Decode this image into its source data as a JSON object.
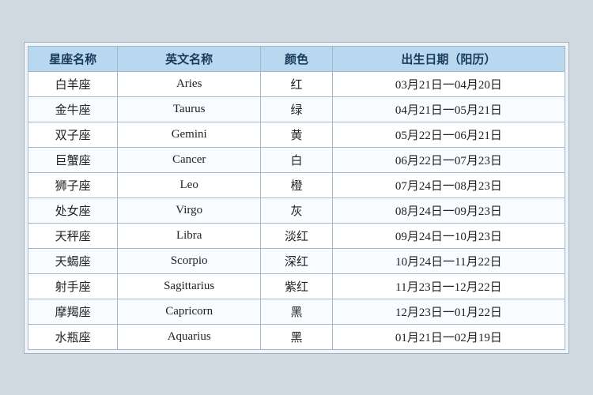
{
  "table": {
    "headers": [
      "星座名称",
      "英文名称",
      "颜色",
      "出生日期（阳历）"
    ],
    "rows": [
      {
        "zh": "白羊座",
        "en": "Aries",
        "color": "红",
        "date": "03月21日一04月20日"
      },
      {
        "zh": "金牛座",
        "en": "Taurus",
        "color": "绿",
        "date": "04月21日一05月21日"
      },
      {
        "zh": "双子座",
        "en": "Gemini",
        "color": "黄",
        "date": "05月22日一06月21日"
      },
      {
        "zh": "巨蟹座",
        "en": "Cancer",
        "color": "白",
        "date": "06月22日一07月23日"
      },
      {
        "zh": "狮子座",
        "en": "Leo",
        "color": "橙",
        "date": "07月24日一08月23日"
      },
      {
        "zh": "处女座",
        "en": "Virgo",
        "color": "灰",
        "date": "08月24日一09月23日"
      },
      {
        "zh": "天秤座",
        "en": "Libra",
        "color": "淡红",
        "date": "09月24日一10月23日"
      },
      {
        "zh": "天蝎座",
        "en": "Scorpio",
        "color": "深红",
        "date": "10月24日一11月22日"
      },
      {
        "zh": "射手座",
        "en": "Sagittarius",
        "color": "紫红",
        "date": "11月23日一12月22日"
      },
      {
        "zh": "摩羯座",
        "en": "Capricorn",
        "color": "黑",
        "date": "12月23日一01月22日"
      },
      {
        "zh": "水瓶座",
        "en": "Aquarius",
        "color": "黑",
        "date": "01月21日一02月19日"
      }
    ]
  }
}
